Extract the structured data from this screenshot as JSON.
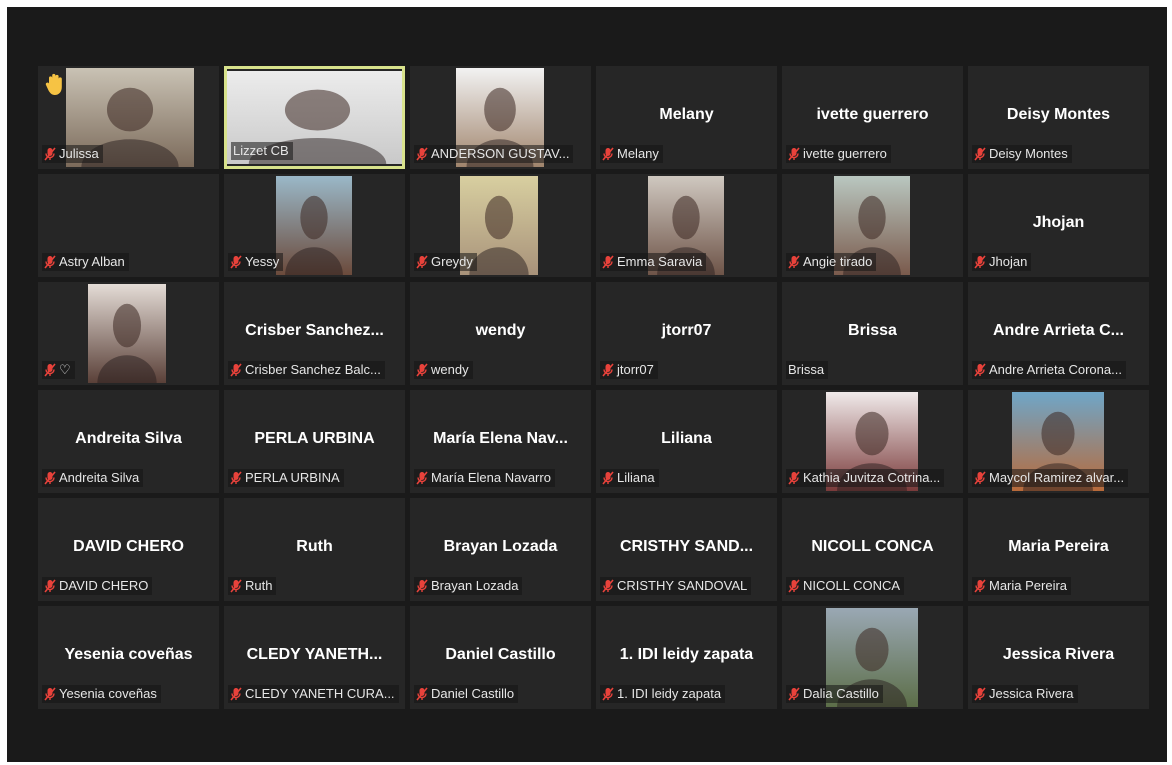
{
  "meeting": {
    "icons": {
      "muted": "mic-muted-icon",
      "raise_hand": "raised-hand-icon",
      "heart": "heart-icon"
    },
    "colors": {
      "active_speaker_border": "#d8e28c",
      "muted_icon": "#e8423b",
      "tile_bg": "#262626",
      "screen_bg": "#1a1a1a"
    },
    "participants": [
      {
        "display_name": "",
        "label": "Julissa",
        "muted": true,
        "video": true,
        "hand_raised": true
      },
      {
        "display_name": "",
        "label": "Lizzet CB",
        "muted": false,
        "video": true,
        "active_speaker": true
      },
      {
        "display_name": "",
        "label": "ANDERSON GUSTAV...",
        "muted": true,
        "video": true
      },
      {
        "display_name": "Melany",
        "label": "Melany",
        "muted": true,
        "video": false
      },
      {
        "display_name": "ivette guerrero",
        "label": "ivette guerrero",
        "muted": true,
        "video": false
      },
      {
        "display_name": "Deisy Montes",
        "label": "Deisy Montes",
        "muted": true,
        "video": false
      },
      {
        "display_name": "",
        "label": "Astry Alban",
        "muted": true,
        "video": false
      },
      {
        "display_name": "",
        "label": "Yessy",
        "muted": true,
        "video": true
      },
      {
        "display_name": "",
        "label": "Greydy",
        "muted": true,
        "video": true
      },
      {
        "display_name": "",
        "label": "Emma Saravia",
        "muted": true,
        "video": true
      },
      {
        "display_name": "",
        "label": "Angie tirado",
        "muted": true,
        "video": true
      },
      {
        "display_name": "Jhojan",
        "label": "Jhojan",
        "muted": true,
        "video": false
      },
      {
        "display_name": "",
        "label": "♡",
        "muted": true,
        "video": true
      },
      {
        "display_name": "Crisber Sanchez...",
        "label": "Crisber Sanchez Balc...",
        "muted": true,
        "video": false
      },
      {
        "display_name": "wendy",
        "label": "wendy",
        "muted": true,
        "video": false
      },
      {
        "display_name": "jtorr07",
        "label": "jtorr07",
        "muted": true,
        "video": false
      },
      {
        "display_name": "Brissa",
        "label": "Brissa",
        "muted": false,
        "video": false
      },
      {
        "display_name": "Andre Arrieta C...",
        "label": "Andre Arrieta Corona...",
        "muted": true,
        "video": false
      },
      {
        "display_name": "Andreita Silva",
        "label": "Andreita Silva",
        "muted": true,
        "video": false
      },
      {
        "display_name": "PERLA URBINA",
        "label": "PERLA URBINA",
        "muted": true,
        "video": false
      },
      {
        "display_name": "María Elena Nav...",
        "label": "María Elena Navarro",
        "muted": true,
        "video": false
      },
      {
        "display_name": "Liliana",
        "label": "Liliana",
        "muted": true,
        "video": false
      },
      {
        "display_name": "",
        "label": "Kathia Juvitza Cotrina...",
        "muted": true,
        "video": true
      },
      {
        "display_name": "",
        "label": "Maycol Ramirez alvar...",
        "muted": true,
        "video": true
      },
      {
        "display_name": "DAVID CHERO",
        "label": "DAVID CHERO",
        "muted": true,
        "video": false
      },
      {
        "display_name": "Ruth",
        "label": "Ruth",
        "muted": true,
        "video": false
      },
      {
        "display_name": "Brayan Lozada",
        "label": "Brayan Lozada",
        "muted": true,
        "video": false
      },
      {
        "display_name": "CRISTHY SAND...",
        "label": "CRISTHY SANDOVAL",
        "muted": true,
        "video": false
      },
      {
        "display_name": "NICOLL CONCA",
        "label": "NICOLL CONCA",
        "muted": true,
        "video": false
      },
      {
        "display_name": "Maria Pereira",
        "label": "Maria Pereira",
        "muted": true,
        "video": false
      },
      {
        "display_name": "Yesenia coveñas",
        "label": "Yesenia coveñas",
        "muted": true,
        "video": false
      },
      {
        "display_name": "CLEDY YANETH...",
        "label": "CLEDY YANETH CURA...",
        "muted": true,
        "video": false
      },
      {
        "display_name": "Daniel Castillo",
        "label": "Daniel Castillo",
        "muted": true,
        "video": false
      },
      {
        "display_name": "1. IDI leidy zapata",
        "label": "1. IDI leidy zapata",
        "muted": true,
        "video": false
      },
      {
        "display_name": "",
        "label": "Dalia Castillo",
        "muted": true,
        "video": true
      },
      {
        "display_name": "Jessica Rivera",
        "label": "Jessica Rivera",
        "muted": true,
        "video": false
      }
    ]
  }
}
